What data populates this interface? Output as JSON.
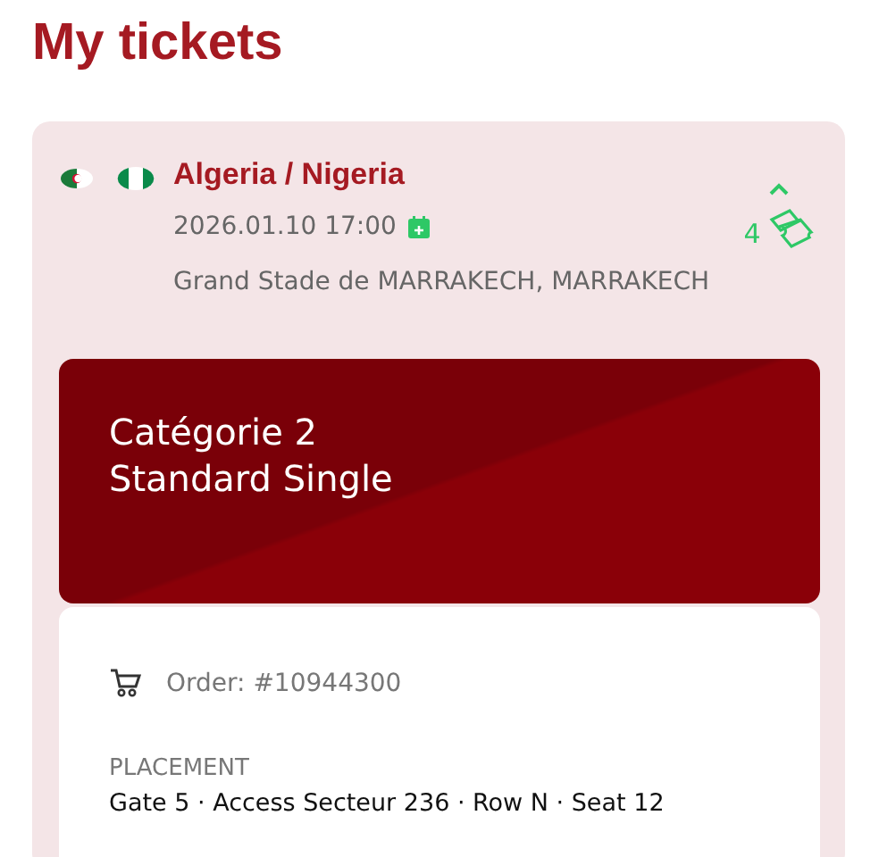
{
  "page_title": "My tickets",
  "ticket": {
    "match": "Algeria / Nigeria",
    "datetime": "2026.01.10 17:00",
    "venue": "Grand Stade de MARRAKECH, MARRAKECH",
    "expanded": true,
    "ticket_count": "4",
    "category": {
      "line1": "Catégorie 2",
      "line2": "Standard Single"
    },
    "order": "Order: #10944300",
    "placement_label": "PLACEMENT",
    "placement": "Gate 5 · Access Secteur 236 · Row N · Seat 12"
  }
}
